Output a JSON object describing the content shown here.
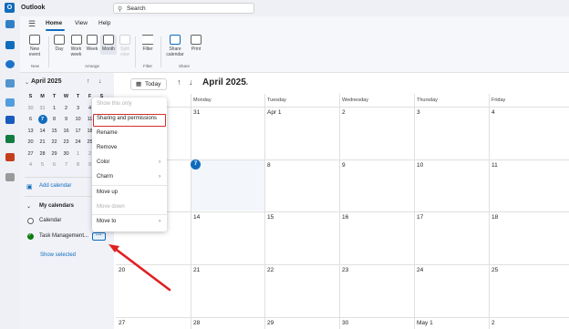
{
  "app": {
    "title": "Outlook"
  },
  "search": {
    "placeholder": "Search"
  },
  "ribbon": {
    "tabs": [
      "Home",
      "View",
      "Help"
    ],
    "buttons": {
      "new_event": "New event",
      "day": "Day",
      "work_week": "Work week",
      "week": "Week",
      "month": "Month",
      "split_view": "Split view",
      "filter": "Filter",
      "share_calendar": "Share calendar",
      "print": "Print"
    },
    "groups": {
      "new": "New",
      "arrange": "Arrange",
      "filter": "Filter",
      "share": "Share"
    }
  },
  "mini_calendar": {
    "title": "April 2025",
    "weekdays": [
      "S",
      "M",
      "T",
      "W",
      "T",
      "F",
      "S"
    ],
    "weeks": [
      [
        "30",
        "31",
        "1",
        "2",
        "3",
        "4",
        "5"
      ],
      [
        "6",
        "7",
        "8",
        "9",
        "10",
        "11",
        "12"
      ],
      [
        "13",
        "14",
        "15",
        "16",
        "17",
        "18",
        "19"
      ],
      [
        "20",
        "21",
        "22",
        "23",
        "24",
        "25",
        "26"
      ],
      [
        "27",
        "28",
        "29",
        "30",
        "1",
        "2",
        "3"
      ],
      [
        "4",
        "5",
        "6",
        "7",
        "8",
        "9",
        "10"
      ]
    ],
    "today": "7"
  },
  "left_pane": {
    "add_calendar": "Add calendar",
    "my_calendars": "My calendars",
    "calendars": [
      {
        "name": "Calendar",
        "color": "#616161",
        "checked": false
      },
      {
        "name": "Task Management...",
        "color": "#107c10",
        "checked": true
      }
    ],
    "show_selected": "Show selected"
  },
  "context_menu": {
    "items": [
      {
        "label": "Show this only",
        "disabled": true
      },
      {
        "label": "Sharing and permissions",
        "disabled": false,
        "highlighted": true
      },
      {
        "label": "Rename",
        "disabled": false
      },
      {
        "label": "Remove",
        "disabled": false
      },
      {
        "label": "Color",
        "disabled": false,
        "submenu": true
      },
      {
        "label": "Charm",
        "disabled": false,
        "submenu": true
      },
      {
        "label": "Move up",
        "disabled": false
      },
      {
        "label": "Move down",
        "disabled": true
      },
      {
        "label": "Move to",
        "disabled": false,
        "submenu": true
      }
    ]
  },
  "toolbar": {
    "today": "Today",
    "month_title": "April 2025"
  },
  "month_view": {
    "day_headers": [
      "Sunday",
      "Monday",
      "Tuesday",
      "Wednesday",
      "Thursday",
      "Friday",
      "Saturday"
    ],
    "weeks": [
      [
        "30",
        "31",
        "Apr 1",
        "2",
        "3",
        "4",
        "5"
      ],
      [
        "6",
        "7",
        "8",
        "9",
        "10",
        "11",
        "12"
      ],
      [
        "13",
        "14",
        "15",
        "16",
        "17",
        "18",
        "19"
      ],
      [
        "20",
        "21",
        "22",
        "23",
        "24",
        "25",
        "26"
      ],
      [
        "27",
        "28",
        "29",
        "30",
        "May 1",
        "2",
        "3"
      ]
    ],
    "today": "7"
  },
  "colors": {
    "accent": "#0f6cbd",
    "highlight_border": "#d32f2f",
    "annotation_arrow": "#e02020"
  }
}
